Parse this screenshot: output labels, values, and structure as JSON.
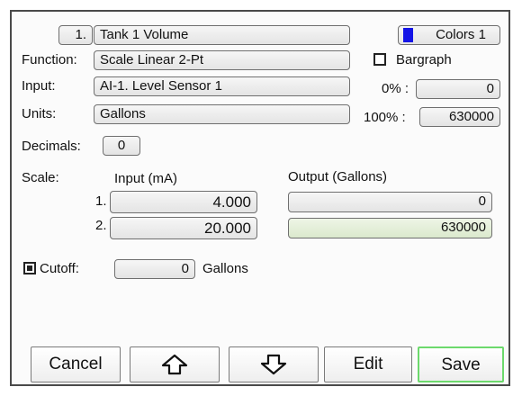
{
  "header": {
    "item_number": "1.",
    "item_name": "Tank 1 Volume",
    "colors_button": "Colors 1",
    "colors_swatch": "#1414e6"
  },
  "function": {
    "label": "Function:",
    "value": "Scale Linear 2-Pt"
  },
  "bargraph": {
    "label": "Bargraph",
    "checked": false
  },
  "input": {
    "label": "Input:",
    "value": "AI-1. Level Sensor 1"
  },
  "units": {
    "label": "Units:",
    "value": "Gallons"
  },
  "range": {
    "low_label": "0% :",
    "low_value": "0",
    "high_label": "100% :",
    "high_value": "630000"
  },
  "decimals": {
    "label": "Decimals:",
    "value": "0"
  },
  "scale": {
    "label": "Scale:",
    "input_header": "Input (mA)",
    "output_header": "Output (Gallons)",
    "rows": [
      {
        "index": "1.",
        "input": "4.000",
        "output": "0"
      },
      {
        "index": "2.",
        "input": "20.000",
        "output": "630000"
      }
    ]
  },
  "cutoff": {
    "label": "Cutoff:",
    "checked": true,
    "value": "0",
    "units": "Gallons"
  },
  "buttons": {
    "cancel": "Cancel",
    "up_icon": "arrow-up-icon",
    "down_icon": "arrow-down-icon",
    "edit": "Edit",
    "save": "Save"
  }
}
